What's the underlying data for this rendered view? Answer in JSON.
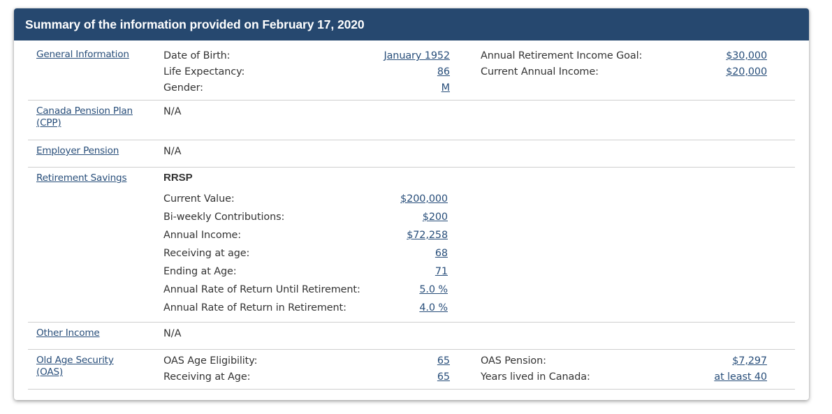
{
  "header": {
    "title": "Summary of the information provided on February 17, 2020"
  },
  "colors": {
    "header_bg": "#26486f",
    "link": "#284e7a",
    "text": "#333333",
    "divider": "#cfcfcf"
  },
  "sections": {
    "general": {
      "label": "General Information",
      "left": [
        {
          "key": "Date of Birth:",
          "value": "January 1952"
        },
        {
          "key": "Life Expectancy:",
          "value": "86"
        },
        {
          "key": "Gender:",
          "value": "M"
        }
      ],
      "right": [
        {
          "key": "Annual Retirement Income Goal:",
          "value": "$30,000"
        },
        {
          "key": "Current Annual Income:",
          "value": "$20,000"
        }
      ]
    },
    "cpp": {
      "label_line1": "Canada Pension Plan",
      "label_line2": "(CPP)",
      "value": "N/A"
    },
    "employer": {
      "label": "Employer Pension",
      "value": "N/A"
    },
    "savings": {
      "label": "Retirement Savings",
      "subheading": "RRSP",
      "items": [
        {
          "key": "Current Value:",
          "value": "$200,000"
        },
        {
          "key": "Bi-weekly Contributions:",
          "value": "$200"
        },
        {
          "key": "Annual Income:",
          "value": "$72,258"
        },
        {
          "key": "Receiving at age:",
          "value": "68"
        },
        {
          "key": "Ending at Age:",
          "value": "71"
        },
        {
          "key": "Annual Rate of Return Until Retirement:",
          "value": "5.0 %"
        },
        {
          "key": "Annual Rate of Return in Retirement:",
          "value": "4.0 %"
        }
      ]
    },
    "other": {
      "label": "Other Income",
      "value": "N/A"
    },
    "oas": {
      "label_line1": "Old Age Security",
      "label_line2": "(OAS)",
      "left": [
        {
          "key": "OAS Age Eligibility:",
          "value": "65"
        },
        {
          "key": "Receiving at Age:",
          "value": "65"
        }
      ],
      "right": [
        {
          "key": "OAS Pension:",
          "value": "$7,297"
        },
        {
          "key": "Years lived in Canada:",
          "value": "at least 40"
        }
      ]
    }
  }
}
